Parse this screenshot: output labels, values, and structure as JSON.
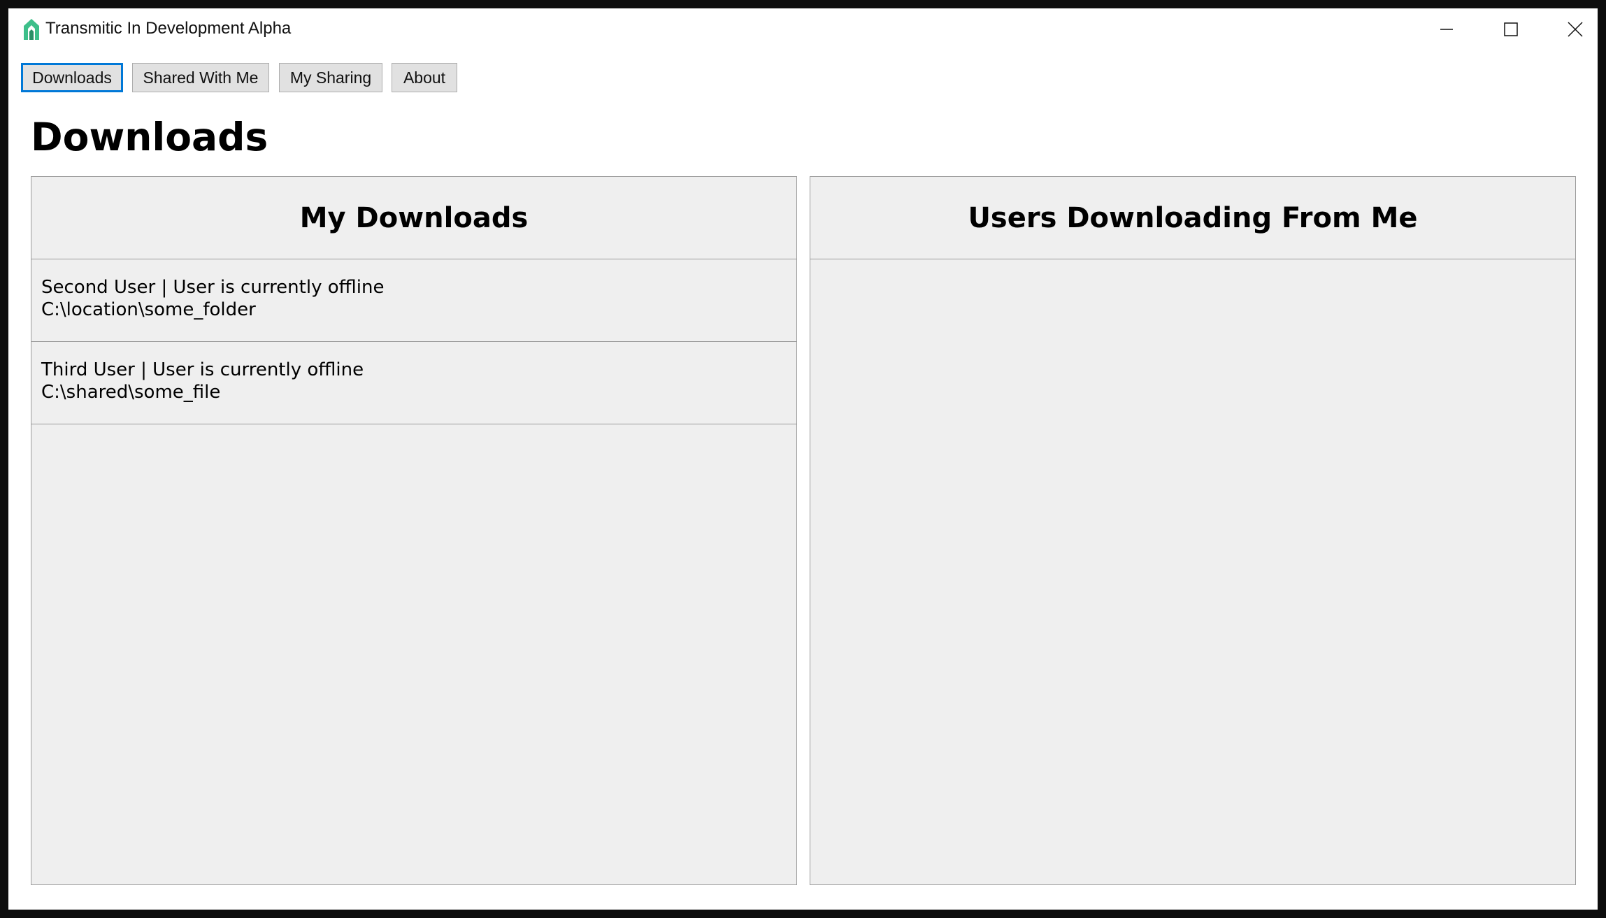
{
  "window": {
    "title": "Transmitic In Development Alpha",
    "icon": "transmitic-logo-icon",
    "controls": [
      "minimize-icon",
      "maximize-icon",
      "close-icon"
    ]
  },
  "nav": {
    "tabs": [
      {
        "label": "Downloads",
        "active": true
      },
      {
        "label": "Shared With Me",
        "active": false
      },
      {
        "label": "My Sharing",
        "active": false
      },
      {
        "label": "About",
        "active": false
      }
    ]
  },
  "page": {
    "title": "Downloads"
  },
  "my_downloads": {
    "title": "My Downloads",
    "items": [
      {
        "status": "Second User | User is currently offline",
        "path": "C:\\location\\some_folder"
      },
      {
        "status": "Third User | User is currently offline",
        "path": "C:\\shared\\some_file"
      }
    ]
  },
  "users_downloading": {
    "title": "Users Downloading From Me",
    "items": []
  },
  "colors": {
    "accent": "#0078d7",
    "panel_bg": "#efefef",
    "button_bg": "#e1e1e1",
    "logo_green": "#3dbf8a"
  }
}
